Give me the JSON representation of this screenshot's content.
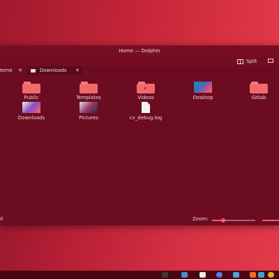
{
  "window": {
    "title": "Home — Dolphin"
  },
  "toolbar": {
    "split_label": "Split"
  },
  "tabs": [
    {
      "label": "Home"
    },
    {
      "label": "Downloads"
    }
  ],
  "files": [
    {
      "label": "Public",
      "icon": "folder-icon"
    },
    {
      "label": "Templates",
      "icon": "folder-icon"
    },
    {
      "label": "Videos",
      "icon": "folder-video-icon"
    },
    {
      "label": "Desktop",
      "icon": "desktop-thumbnail-icon"
    },
    {
      "label": "Gitlab",
      "icon": "folder-icon"
    },
    {
      "label": "Downloads",
      "icon": "downloads-thumbnail-icon"
    },
    {
      "label": "Pictures",
      "icon": "pictures-thumbnail-icon"
    },
    {
      "label": "cv_debug.log",
      "icon": "text-file-icon"
    }
  ],
  "statusbar": {
    "left_text": "0",
    "zoom_label": "Zoom:",
    "zoom_level": 0.25
  },
  "colors": {
    "accent": "#ff5a6a",
    "window_bg": "#6b0c20",
    "folder": "#f06a6c"
  },
  "taskbar": {
    "icons": [
      "terminal-icon",
      "files-icon",
      "folder-icon",
      "browser-icon",
      "settings-icon",
      "brave-icon",
      "photos-icon",
      "chrome-icon"
    ]
  }
}
